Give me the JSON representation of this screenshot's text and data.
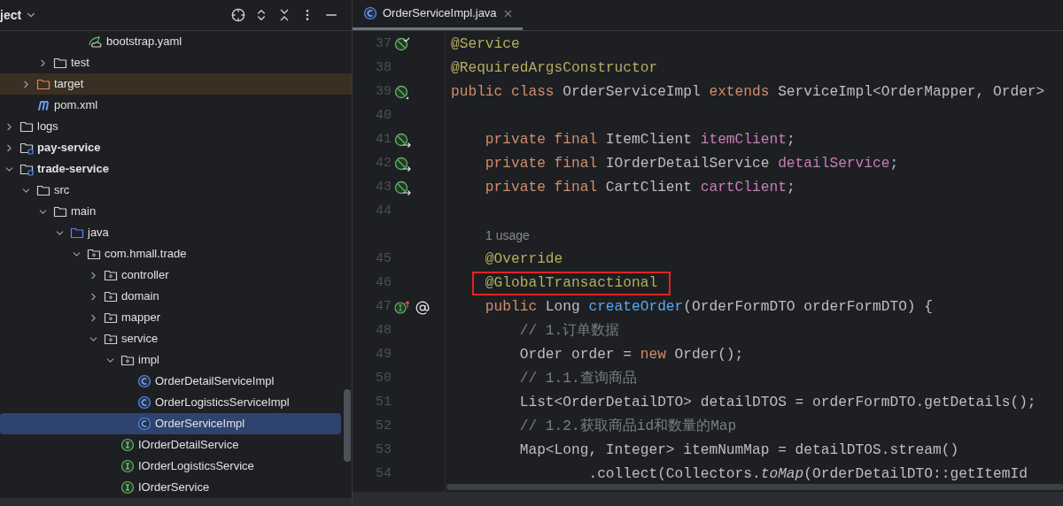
{
  "project_panel": {
    "title": "ject",
    "toolbar": [
      {
        "kind": "locate"
      },
      {
        "kind": "expand"
      },
      {
        "kind": "collapse"
      },
      {
        "kind": "more"
      },
      {
        "kind": "minimize"
      }
    ],
    "tree": [
      {
        "children": [
          {
            "children": [
              {
                "children": [
                  {
                    "children": [
                      {
                        "label": "bootstrap.yaml",
                        "kind": "yaml",
                        "selected": false
                      }
                    ]
                  }
                ]
              },
              {
                "label": "test",
                "kind": "folder",
                "expanded": false,
                "selected": false
              }
            ]
          },
          {
            "label": "target",
            "kind": "excluded-folder",
            "expanded": false,
            "selected": false
          },
          {
            "label": "pom.xml",
            "kind": "maven",
            "selected": false
          }
        ]
      },
      {
        "label": "logs",
        "kind": "folder",
        "expanded": false,
        "selected": false
      },
      {
        "label": "pay-service",
        "kind": "module",
        "expanded": false,
        "selected": false
      },
      {
        "label": "trade-service",
        "kind": "module",
        "expanded": true,
        "selected": false,
        "children": [
          {
            "label": "src",
            "kind": "folder",
            "expanded": true,
            "selected": false,
            "children": [
              {
                "label": "main",
                "kind": "folder",
                "expanded": true,
                "selected": false,
                "children": [
                  {
                    "label": "java",
                    "kind": "source-folder",
                    "expanded": true,
                    "selected": false,
                    "children": [
                      {
                        "label": "com.hmall.trade",
                        "kind": "package",
                        "expanded": true,
                        "selected": false,
                        "children": [
                          {
                            "label": "controller",
                            "kind": "package",
                            "expanded": false,
                            "selected": false
                          },
                          {
                            "label": "domain",
                            "kind": "package",
                            "expanded": false,
                            "selected": false
                          },
                          {
                            "label": "mapper",
                            "kind": "package",
                            "expanded": false,
                            "selected": false
                          },
                          {
                            "label": "service",
                            "kind": "package",
                            "expanded": true,
                            "selected": false,
                            "children": [
                              {
                                "label": "impl",
                                "kind": "package",
                                "expanded": true,
                                "selected": false,
                                "children": [
                                  {
                                    "label": "OrderDetailServiceImpl",
                                    "kind": "class",
                                    "selected": false
                                  },
                                  {
                                    "label": "OrderLogisticsServiceImpl",
                                    "kind": "class",
                                    "selected": false
                                  },
                                  {
                                    "label": "OrderServiceImpl",
                                    "kind": "class",
                                    "selected": true
                                  }
                                ]
                              },
                              {
                                "label": "IOrderDetailService",
                                "kind": "interface",
                                "selected": false
                              },
                              {
                                "label": "IOrderLogisticsService",
                                "kind": "interface",
                                "selected": false
                              },
                              {
                                "label": "IOrderService",
                                "kind": "interface",
                                "selected": false
                              }
                            ]
                          }
                        ]
                      }
                    ]
                  }
                ]
              }
            ]
          }
        ]
      }
    ]
  },
  "editor": {
    "tabs": [
      {
        "label": "OrderServiceImpl.java",
        "kind": "class",
        "selected": true
      }
    ],
    "lines": [
      {
        "kind": "code",
        "number": "37",
        "gutter": {
          "kind": "bean-check"
        },
        "boxed": false,
        "tokens": [
          {
            "kind": "annotation",
            "text": "@Service"
          }
        ]
      },
      {
        "kind": "code",
        "number": "38",
        "boxed": false,
        "tokens": [
          {
            "kind": "annotation",
            "text": "@RequiredArgsConstructor"
          }
        ]
      },
      {
        "kind": "code",
        "number": "39",
        "gutter": {
          "kind": "bean"
        },
        "boxed": false,
        "tokens": [
          {
            "kind": "keyword",
            "text": "public class "
          },
          {
            "kind": "plain",
            "text": "OrderServiceImpl "
          },
          {
            "kind": "keyword",
            "text": "extends "
          },
          {
            "kind": "plain",
            "text": "ServiceImpl<OrderMapper, Order>"
          }
        ]
      },
      {
        "kind": "code",
        "number": "40",
        "boxed": false
      },
      {
        "kind": "code",
        "number": "41",
        "gutter": {
          "kind": "bean-inject"
        },
        "boxed": false,
        "tokens": [
          {
            "kind": "keyword",
            "text": "    private final "
          },
          {
            "kind": "plain",
            "text": "ItemClient "
          },
          {
            "kind": "field",
            "text": "itemClient"
          },
          {
            "kind": "plain",
            "text": ";"
          }
        ]
      },
      {
        "kind": "code",
        "number": "42",
        "gutter": {
          "kind": "bean-inject"
        },
        "boxed": false,
        "tokens": [
          {
            "kind": "keyword",
            "text": "    private final "
          },
          {
            "kind": "plain",
            "text": "IOrderDetailService "
          },
          {
            "kind": "field",
            "text": "detailService"
          },
          {
            "kind": "plain",
            "text": ";"
          }
        ]
      },
      {
        "kind": "code",
        "number": "43",
        "gutter": {
          "kind": "bean-inject"
        },
        "boxed": false,
        "tokens": [
          {
            "kind": "keyword",
            "text": "    private final "
          },
          {
            "kind": "plain",
            "text": "CartClient "
          },
          {
            "kind": "field",
            "text": "cartClient"
          },
          {
            "kind": "plain",
            "text": ";"
          }
        ]
      },
      {
        "kind": "code",
        "number": "44",
        "boxed": false
      },
      {
        "kind": "hint",
        "text": "1 usage"
      },
      {
        "kind": "code",
        "number": "45",
        "boxed": false,
        "tokens": [
          {
            "kind": "annotation",
            "text": "    @Override"
          }
        ]
      },
      {
        "kind": "code",
        "number": "46",
        "boxed": true,
        "tokens": [
          {
            "kind": "annotation",
            "text": "    @GlobalTransactional"
          }
        ]
      },
      {
        "kind": "code",
        "number": "47",
        "gutter": {
          "kind": "implements-at"
        },
        "boxed": false,
        "tokens": [
          {
            "kind": "keyword",
            "text": "    public "
          },
          {
            "kind": "plain",
            "text": "Long "
          },
          {
            "kind": "method",
            "text": "createOrder"
          },
          {
            "kind": "plain",
            "text": "(OrderFormDTO orderFormDTO) {"
          }
        ]
      },
      {
        "kind": "code",
        "number": "48",
        "boxed": false,
        "tokens": [
          {
            "kind": "comment",
            "text": "        // 1.订单数据"
          }
        ]
      },
      {
        "kind": "code",
        "number": "49",
        "boxed": false,
        "tokens": [
          {
            "kind": "plain",
            "text": "        Order order = "
          },
          {
            "kind": "keyword",
            "text": "new "
          },
          {
            "kind": "plain",
            "text": "Order();"
          }
        ]
      },
      {
        "kind": "code",
        "number": "50",
        "boxed": false,
        "tokens": [
          {
            "kind": "comment",
            "text": "        // 1.1.查询商品"
          }
        ]
      },
      {
        "kind": "code",
        "number": "51",
        "boxed": false,
        "tokens": [
          {
            "kind": "plain",
            "text": "        List<OrderDetailDTO> detailDTOS = orderFormDTO.getDetails();"
          }
        ]
      },
      {
        "kind": "code",
        "number": "52",
        "boxed": false,
        "tokens": [
          {
            "kind": "comment",
            "text": "        // 1.2.获取商品id和数量的Map"
          }
        ]
      },
      {
        "kind": "code",
        "number": "53",
        "boxed": false,
        "tokens": [
          {
            "kind": "plain",
            "text": "        Map<Long, Integer> itemNumMap = detailDTOS.stream()"
          }
        ]
      },
      {
        "kind": "code",
        "number": "54",
        "boxed": false,
        "tokens": [
          {
            "kind": "plain",
            "text": "                .collect(Collectors."
          },
          {
            "kind": "static",
            "text": "toMap"
          },
          {
            "kind": "plain",
            "text": "(OrderDetailDTO::getItemId"
          }
        ]
      }
    ]
  }
}
